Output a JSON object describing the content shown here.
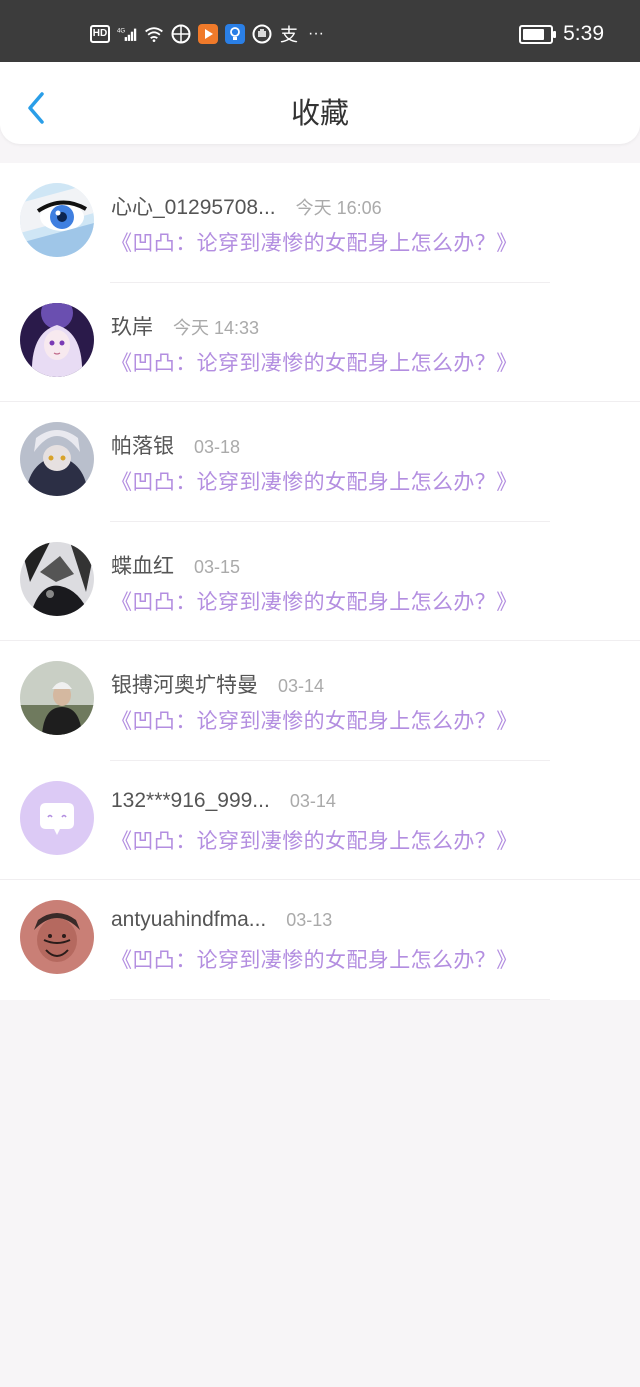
{
  "status_bar": {
    "network_type": "HD",
    "signal_label": "4G",
    "notification_app_label": "支",
    "more_indicator": "···",
    "time": "5:39",
    "battery_level_pct": 80
  },
  "header": {
    "title": "收藏",
    "back_icon": "chevron-left-icon"
  },
  "colors": {
    "accent_back": "#2a9ee8",
    "title_link": "#b38ee0",
    "placeholder_avatar": "#dccaf5"
  },
  "favorites": [
    {
      "name": "心心_01295708...",
      "time": "今天 16:06",
      "title": "《凹凸：论穿到凄惨的女配身上怎么办？》"
    },
    {
      "name": "玖岸",
      "time": "今天 14:33",
      "title": "《凹凸：论穿到凄惨的女配身上怎么办？》"
    },
    {
      "name": "帕落银",
      "time": "03-18",
      "title": "《凹凸：论穿到凄惨的女配身上怎么办？》"
    },
    {
      "name": "蝶血红",
      "time": "03-15",
      "title": "《凹凸：论穿到凄惨的女配身上怎么办？》"
    },
    {
      "name": "银搏河奥圹特曼",
      "time": "03-14",
      "title": "《凹凸：论穿到凄惨的女配身上怎么办？》"
    },
    {
      "name": "132***916_999...",
      "time": "03-14",
      "title": "《凹凸：论穿到凄惨的女配身上怎么办？》"
    },
    {
      "name": "antyuahindfma...",
      "time": "03-13",
      "title": "《凹凸：论穿到凄惨的女配身上怎么办？》"
    }
  ]
}
